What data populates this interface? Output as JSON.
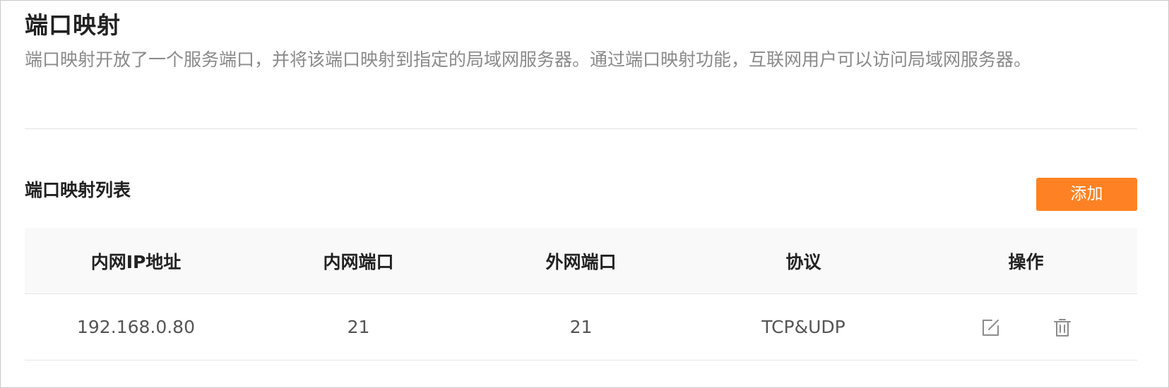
{
  "header": {
    "title": "端口映射",
    "description": "端口映射开放了一个服务端口，并将该端口映射到指定的局域网服务器。通过端口映射功能，互联网用户可以访问局域网服务器。"
  },
  "list": {
    "title": "端口映射列表",
    "add_label": "添加",
    "columns": [
      "内网IP地址",
      "内网端口",
      "外网端口",
      "协议",
      "操作"
    ],
    "rows": [
      {
        "ip": "192.168.0.80",
        "internal_port": "21",
        "external_port": "21",
        "protocol": "TCP&UDP",
        "actions": [
          "edit-icon",
          "trash-icon"
        ]
      }
    ]
  },
  "colors": {
    "accent": "#fe8223",
    "icon": "#8c8c8c"
  }
}
